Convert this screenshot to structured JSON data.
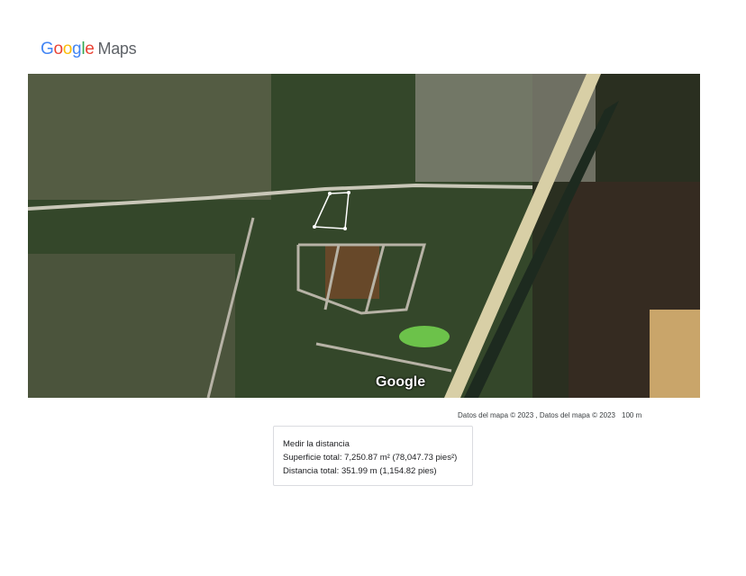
{
  "header": {
    "logo_letters": [
      {
        "ch": "G",
        "color": "#4285F4"
      },
      {
        "ch": "o",
        "color": "#EA4335"
      },
      {
        "ch": "o",
        "color": "#FBBC05"
      },
      {
        "ch": "g",
        "color": "#4285F4"
      },
      {
        "ch": "l",
        "color": "#34A853"
      },
      {
        "ch": "e",
        "color": "#EA4335"
      }
    ],
    "product": "Maps"
  },
  "map": {
    "style": "satellite",
    "watermark": "Google",
    "attribution": "Datos del mapa © 2023 , Datos del mapa © 2023",
    "scale_label": "100 m"
  },
  "measure_card": {
    "title": "Medir la distancia",
    "area": "Superficie total: 7,250.87 m² (78,047.73 pies²)",
    "distance": "Distancia total: 351.99 m (1,154.82 pies)"
  },
  "colors": {
    "vegetation": "#2f4a22",
    "road": "#c9c7b8",
    "highway": "#d8cfa6",
    "water_canal": "#1d2a1f"
  }
}
